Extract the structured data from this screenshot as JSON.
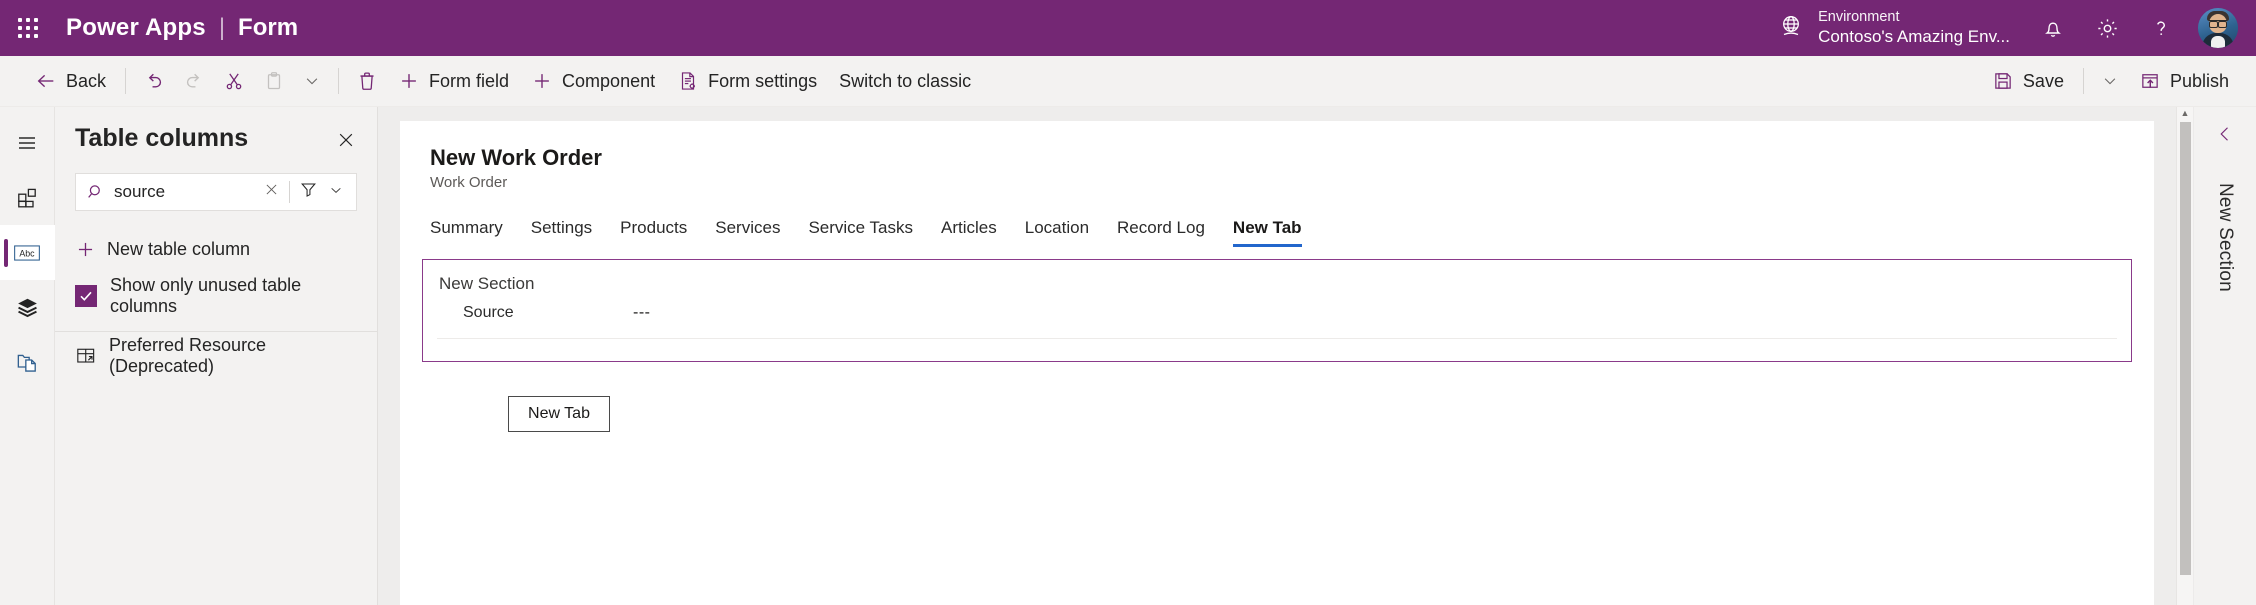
{
  "suitebar": {
    "waffle_label": "App launcher",
    "app_name": "Power Apps",
    "separator": "|",
    "page_name": "Form",
    "environment_label": "Environment",
    "environment_name": "Contoso's Amazing Env...",
    "globe_icon": "globe-icon",
    "notification_icon": "bell-icon",
    "settings_icon": "gear-icon",
    "help_icon": "question-mark-icon",
    "avatar_icon": "user-avatar",
    "brand_color": "#742774"
  },
  "commandbar": {
    "back": "Back",
    "undo_icon": "undo-icon",
    "redo_icon": "redo-icon",
    "cut_icon": "scissors-icon",
    "paste_icon": "clipboard-icon",
    "paste_caret_icon": "chevron-down-icon",
    "delete_icon": "trash-icon",
    "form_field": "Form field",
    "component": "Component",
    "form_settings": "Form settings",
    "switch_to_classic": "Switch to classic",
    "save": "Save",
    "save_caret_icon": "chevron-down-icon",
    "publish": "Publish"
  },
  "rail": {
    "items": [
      {
        "name": "menu-icon",
        "label": "Menu",
        "selected": false
      },
      {
        "name": "components-icon",
        "label": "Components",
        "selected": false
      },
      {
        "name": "table-columns-icon",
        "label": "Table columns",
        "selected": true
      },
      {
        "name": "layers-icon",
        "label": "Tree view",
        "selected": false
      },
      {
        "name": "pages-icon",
        "label": "Pages",
        "selected": false
      }
    ]
  },
  "panel": {
    "title": "Table columns",
    "close_icon": "close-icon",
    "search": {
      "value": "source",
      "placeholder": "Search",
      "search_icon": "search-icon",
      "clear_icon": "clear-icon",
      "filter_icon": "filter-icon",
      "filter_caret_icon": "chevron-down-icon"
    },
    "new_column_label": "New table column",
    "new_column_icon": "plus-icon",
    "show_unused_label": "Show only unused table columns",
    "show_unused_checked": true,
    "columns": [
      {
        "label": "Preferred Resource (Deprecated)",
        "icon": "lookup-column-icon"
      }
    ]
  },
  "canvas": {
    "form_title": "New Work Order",
    "form_subtitle": "Work Order",
    "tabs": [
      {
        "label": "Summary",
        "active": false
      },
      {
        "label": "Settings",
        "active": false
      },
      {
        "label": "Products",
        "active": false
      },
      {
        "label": "Services",
        "active": false
      },
      {
        "label": "Service Tasks",
        "active": false
      },
      {
        "label": "Articles",
        "active": false
      },
      {
        "label": "Location",
        "active": false
      },
      {
        "label": "Record Log",
        "active": false
      },
      {
        "label": "New Tab",
        "active": true
      }
    ],
    "active_tab_underline_color": "#2266cc",
    "section": {
      "title": "New Section",
      "border_color": "#8a3a8a",
      "fields": [
        {
          "label": "Source",
          "value": "---"
        }
      ]
    },
    "new_tab_button": "New Tab"
  },
  "rightrail": {
    "collapse_icon": "chevron-left-icon",
    "label": "New Section"
  },
  "scrollbar": {
    "up_arrow_icon": "caret-up-icon"
  }
}
